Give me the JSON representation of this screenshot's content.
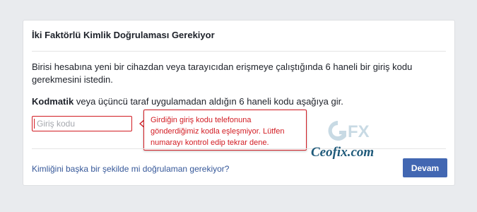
{
  "dialog": {
    "title": "İki Faktörlü Kimlik Doğrulaması Gerekiyor",
    "description": "Birisi hesabına yeni bir cihazdan veya tarayıcıdan erişmeye çalıştığında 6 haneli bir giriş kodu gerekmesini istedin.",
    "instruction_bold": "Kodmatik",
    "instruction_rest": " veya üçüncü taraf uygulamadan aldığın 6 haneli kodu aşağıya gir.",
    "code_input": {
      "placeholder": "Giriş kodu",
      "value": ""
    },
    "error_tooltip": "Girdiğin giriş kodu telefonuna gönderdiğimiz kodla eşleşmiyor. Lütfen numarayı kontrol edip tekrar dene.",
    "alt_link": "Kimliğini başka bir şekilde mi doğrulaman gerekiyor?",
    "continue_label": "Devam"
  },
  "watermark": {
    "logo_text": "GFX",
    "site": "Ceofix.com"
  },
  "colors": {
    "background": "#e9ebee",
    "error": "#d21c23",
    "link": "#365899",
    "primary_button": "#4267b2"
  }
}
